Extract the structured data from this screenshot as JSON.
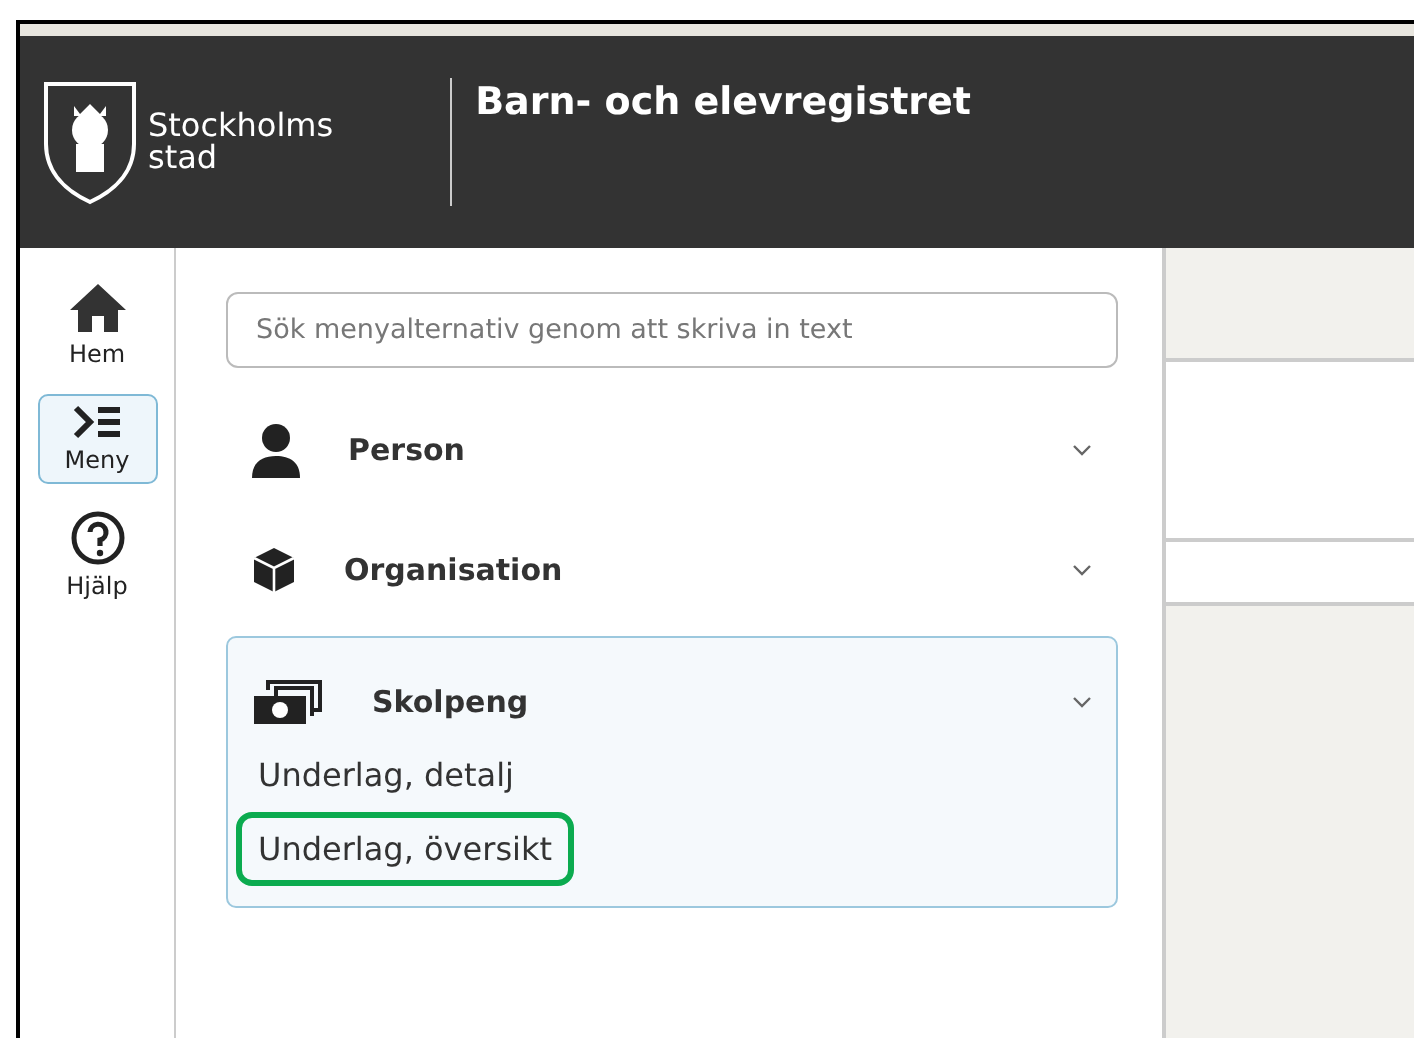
{
  "header": {
    "logo_text": [
      "Stockholms",
      "stad"
    ],
    "title": "Barn- och elevregistret"
  },
  "rail": [
    {
      "label": "Hem",
      "kind": "home",
      "selected": false
    },
    {
      "label": "Meny",
      "kind": "menu",
      "selected": true
    },
    {
      "label": "Hjälp",
      "kind": "help",
      "selected": false
    }
  ],
  "search": {
    "placeholder": "Sök menyalternativ genom att skriva in text"
  },
  "menu": [
    {
      "label": "Person",
      "kind": "person",
      "expanded": false
    },
    {
      "label": "Organisation",
      "kind": "box",
      "expanded": false
    },
    {
      "label": "Skolpeng",
      "kind": "money",
      "expanded": true,
      "children": [
        {
          "label": "Underlag, detalj",
          "highlighted": false
        },
        {
          "label": "Underlag, översikt",
          "highlighted": true
        }
      ]
    }
  ]
}
